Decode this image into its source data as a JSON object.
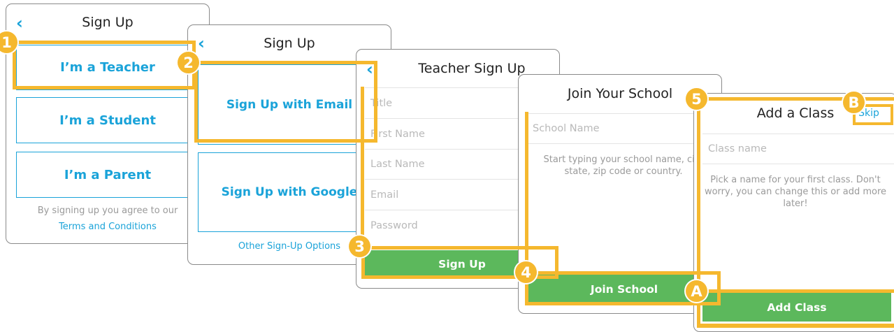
{
  "screen1": {
    "back_icon": "chevron-left-icon",
    "title": "Sign Up",
    "options": [
      "I’m a Teacher",
      "I’m a Student",
      "I’m a Parent"
    ],
    "agree_text": "By signing up you agree to our",
    "terms_link": "Terms and Conditions"
  },
  "screen2": {
    "back_icon": "chevron-left-icon",
    "title": "Sign Up",
    "email_button": "Sign Up with Email",
    "google_button": "Sign Up with Google",
    "other_link": "Other Sign-Up Options"
  },
  "screen3": {
    "back_icon": "chevron-left-icon",
    "title": "Teacher Sign Up",
    "fields": [
      "Title",
      "First Name",
      "Last Name",
      "Email",
      "Password"
    ],
    "submit": "Sign Up"
  },
  "screen4": {
    "title": "Join Your School",
    "placeholder": "School Name",
    "hint": "Start typing your school name, city state, zip code or country.",
    "submit": "Join School"
  },
  "screen5": {
    "title": "Add a Class",
    "skip": "Skip",
    "placeholder": "Class name",
    "hint": "Pick a name for your first class. Don't worry, you can change this or add more later!",
    "submit": "Add Class"
  },
  "markers": [
    "1",
    "2",
    "3",
    "4",
    "5",
    "A",
    "B"
  ],
  "colors": {
    "accent": "#1aa3d9",
    "highlight": "#f5b82e",
    "button_green": "#5cb85c"
  }
}
